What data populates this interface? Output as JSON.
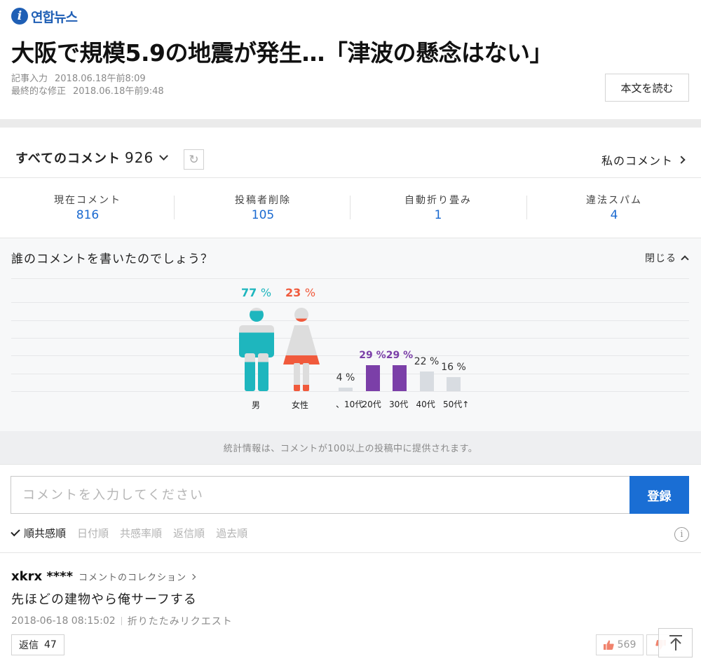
{
  "brand": {
    "logo_text": "연합뉴스"
  },
  "article": {
    "headline": "大阪で規模5.9の地震が発生…「津波の懸念はない」",
    "published_label": "記事入力",
    "published": "2018.06.18午前8:09",
    "modified_label": "最終的な修正",
    "modified": "2018.06.18午前9:48",
    "read_button": "本文を読む"
  },
  "comments_header": {
    "title": "すべてのコメント",
    "count": "926",
    "my_comments": "私のコメント"
  },
  "stats": [
    {
      "label": "現在コメント",
      "value": "816"
    },
    {
      "label": "投稿者削除",
      "value": "105"
    },
    {
      "label": "自動折り畳み",
      "value": "1"
    },
    {
      "label": "違法スパム",
      "value": "4"
    }
  ],
  "demographics": {
    "title": "誰のコメントを書いたのでしょう？",
    "close_label": "閉じる",
    "gender": [
      {
        "label": "男",
        "pct": 77,
        "unit": "%",
        "color": "#1eb6be"
      },
      {
        "label": "女性",
        "pct": 23,
        "unit": "%",
        "color": "#f05a3c"
      }
    ],
    "age": [
      {
        "label": "、10代",
        "pct": 4,
        "text": "4 %"
      },
      {
        "label": "20代",
        "pct": 29,
        "text": "29 %"
      },
      {
        "label": "30代",
        "pct": 29,
        "text": "29 %"
      },
      {
        "label": "40代",
        "pct": 22,
        "text": "22 %"
      },
      {
        "label": "50代↑",
        "pct": 16,
        "text": "16 %"
      }
    ],
    "colors": {
      "age_top": "#7b3fa8",
      "age_rest": "#d8dce1",
      "figure_base": "#dddddd"
    },
    "notice": "統計情報は、コメントが100以上の投稿中に提供されます。"
  },
  "input": {
    "placeholder": "コメントを入力してください",
    "submit": "登録"
  },
  "sort": {
    "active": "順共感順",
    "options": [
      "日付順",
      "共感率順",
      "返信順",
      "過去順"
    ]
  },
  "comment": {
    "user": "xkrx ****",
    "collection": "コメントのコレクション",
    "text": "先ほどの建物やら俺サーフする",
    "timestamp": "2018-06-18 08:15:02",
    "fold_request": "折りたたみリクエスト",
    "reply_label": "返信",
    "reply_count": "47",
    "likes": "569"
  }
}
